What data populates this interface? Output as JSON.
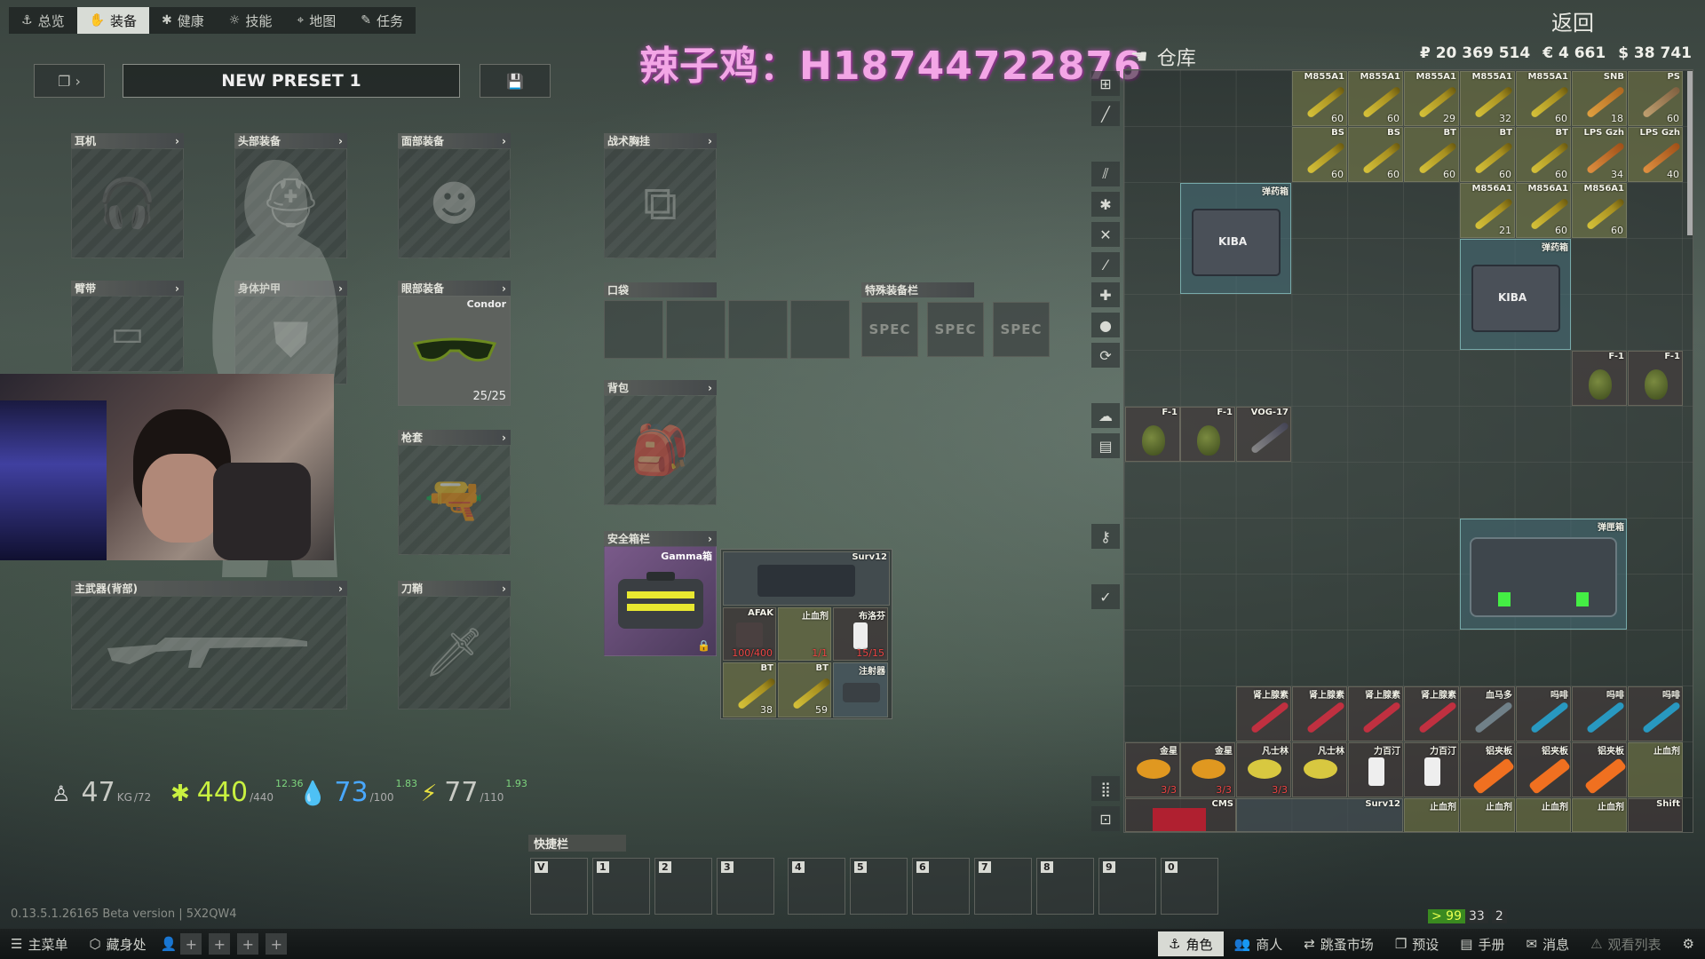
{
  "top_nav": {
    "tabs": [
      {
        "icon": "anchor-icon",
        "label": "总览"
      },
      {
        "icon": "gear-hand-icon",
        "label": "装备"
      },
      {
        "icon": "health-icon",
        "label": "健康"
      },
      {
        "icon": "skills-icon",
        "label": "技能"
      },
      {
        "icon": "map-pin-icon",
        "label": "地图"
      },
      {
        "icon": "tasks-icon",
        "label": "任务"
      }
    ],
    "active_tab": "装备",
    "back_label": "返回"
  },
  "watermark": "辣子鸡：H18744722876",
  "preset": {
    "name": "NEW PRESET 1"
  },
  "gear_slots": {
    "earpiece": "耳机",
    "headwear": "头部装备",
    "facecover": "面部装备",
    "armband": "臂带",
    "body_armor": "身体护甲",
    "eyewear": "眼部装备",
    "eyewear_item": {
      "name": "Condor",
      "durability": "25/25"
    },
    "holster": "枪套",
    "primary": "主武器(背部)",
    "scabbard": "刀鞘",
    "rig": "战术胸挂",
    "pockets": "口袋",
    "special": "特殊装备栏",
    "special_slot_label": "SPEC",
    "backpack": "背包",
    "secure": "安全箱栏",
    "secure_item": "Gamma箱"
  },
  "secure_container_items": [
    {
      "name": "Surv12",
      "type": "kit"
    },
    {
      "name": "AFAK",
      "type": "med",
      "count": "100/400"
    },
    {
      "name": "止血剂",
      "type": "med",
      "count": "1/1"
    },
    {
      "name": "布洛芬",
      "type": "med",
      "count": "15/15"
    },
    {
      "name": "BT",
      "type": "ammo",
      "count": "38"
    },
    {
      "name": "BT",
      "type": "ammo",
      "count": "59"
    },
    {
      "name": "注射器",
      "type": "case"
    }
  ],
  "stats": {
    "weight": {
      "value": "47",
      "unit": "KG",
      "max": "/72"
    },
    "health": {
      "value": "440",
      "max": "/440",
      "regen": "12.36"
    },
    "hydration": {
      "value": "73",
      "max": "/100",
      "regen": "1.83"
    },
    "energy": {
      "value": "77",
      "max": "/110",
      "regen": "1.93"
    }
  },
  "stash": {
    "title": "仓库",
    "money": {
      "rub": "₽ 20 369 514",
      "eur": "€ 4 661",
      "usd": "$ 38 741"
    },
    "row1": [
      {
        "name": "M855A1",
        "count": "60"
      },
      {
        "name": "M855A1",
        "count": "60"
      },
      {
        "name": "M855A1",
        "count": "29"
      },
      {
        "name": "M855A1",
        "count": "32"
      },
      {
        "name": "M855A1",
        "count": "60"
      },
      {
        "name": "SNB",
        "count": "18"
      },
      {
        "name": "PS",
        "count": "60"
      }
    ],
    "row2": [
      {
        "name": "BS",
        "count": "60"
      },
      {
        "name": "BS",
        "count": "60"
      },
      {
        "name": "BT",
        "count": "60"
      },
      {
        "name": "BT",
        "count": "60"
      },
      {
        "name": "BT",
        "count": "60"
      },
      {
        "name": "LPS Gzh",
        "count": "34"
      },
      {
        "name": "LPS Gzh",
        "count": "40"
      }
    ],
    "row3": [
      {
        "name": "M856A1",
        "count": "21"
      },
      {
        "name": "M856A1",
        "count": "60"
      },
      {
        "name": "M856A1",
        "count": "60"
      }
    ],
    "ammo_box_label": "弹药箱",
    "ammo_box_brand": "KIBA",
    "grenades_right": [
      {
        "name": "F-1"
      },
      {
        "name": "F-1"
      }
    ],
    "grenades_left": [
      {
        "name": "F-1"
      },
      {
        "name": "F-1"
      },
      {
        "name": "VOG-17"
      }
    ],
    "grenade_case_label": "弹匣箱",
    "meds_row1": [
      "肾上腺素",
      "肾上腺素",
      "肾上腺素",
      "肾上腺素",
      "血马多",
      "吗啡",
      "吗啡",
      "吗啡",
      "吗啡"
    ],
    "meds_row2": [
      {
        "name": "金星",
        "count": "3/3"
      },
      {
        "name": "金星",
        "count": "3/3"
      },
      {
        "name": "凡士林",
        "count": "3/3"
      },
      {
        "name": "凡士林",
        "count": ""
      },
      {
        "name": "力百汀",
        "count": ""
      },
      {
        "name": "力百汀",
        "count": ""
      },
      {
        "name": "铝夹板",
        "count": ""
      },
      {
        "name": "铝夹板",
        "count": ""
      },
      {
        "name": "铝夹板",
        "count": ""
      },
      {
        "name": "止血剂",
        "count": ""
      }
    ],
    "row_bottom": [
      "CMS",
      "Surv12",
      "止血剂",
      "止血剂",
      "止血剂",
      "止血剂",
      "Shift"
    ]
  },
  "hotbar": {
    "label": "快捷栏",
    "keys": [
      "V",
      "1",
      "2",
      "3",
      "4",
      "5",
      "6",
      "7",
      "8",
      "9",
      "0"
    ]
  },
  "version": "0.13.5.1.26165 Beta version | 5X2QW4",
  "counters": {
    "fps": "> 99",
    "players": "33",
    "group": "2"
  },
  "bottom_bar": {
    "main_menu": "主菜单",
    "hideout": "藏身处",
    "character": "角色",
    "traders": "商人",
    "flea": "跳蚤市场",
    "presets": "预设",
    "handbook": "手册",
    "messages": "消息",
    "watchlist": "观看列表"
  },
  "colors": {
    "accent_light": "#d8dad4",
    "watermark": "#f3a6e6",
    "health_green": "#c8f040",
    "hydration_blue": "#49a8ff"
  }
}
